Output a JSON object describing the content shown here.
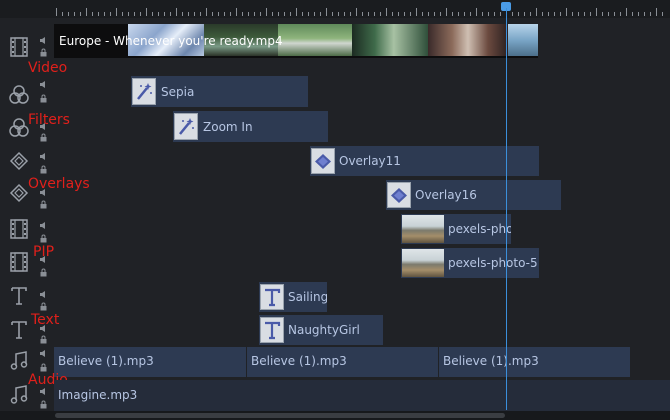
{
  "tracks": {
    "video": {
      "category": "Video",
      "clip": "Europe - Whenever you're ready.mp4"
    },
    "filters": {
      "category": "Filters",
      "clips": [
        "Sepia",
        "Zoom In"
      ]
    },
    "overlays": {
      "category": "Overlays",
      "clips": [
        "Overlay11",
        "Overlay16"
      ]
    },
    "pip": {
      "category": "PIP",
      "clips": [
        "pexels-pho",
        "pexels-photo-5"
      ]
    },
    "text": {
      "category": "Text",
      "clips": [
        "Sailing",
        "NaughtyGirl"
      ]
    },
    "audio": {
      "category": "Audio",
      "clips": [
        "Believe (1).mp3",
        "Believe (1).mp3",
        "Believe (1).mp3",
        "Imagine.mp3"
      ]
    }
  },
  "icons": {
    "video_track": "film-icon",
    "filters_track": "filter-icon",
    "overlays_track": "overlay-icon",
    "pip_track": "film-icon",
    "text_track": "text-icon",
    "audio_track": "music-note-icon",
    "speaker": "speaker-icon",
    "lock": "lock-icon",
    "filter_clip": "magic-wand-icon",
    "overlay_clip": "diamond-icon",
    "text_clip": "letter-t-icon"
  },
  "colors": {
    "background": "#1d1f22",
    "clip": "#2d3a52",
    "clip_text": "#b7c6e3",
    "category_label": "#e0201b",
    "playhead": "#3b8fdb"
  }
}
